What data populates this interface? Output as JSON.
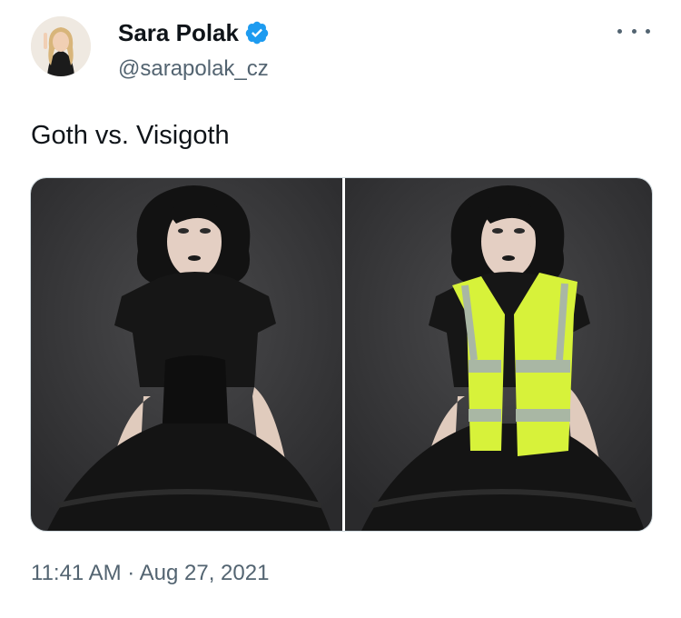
{
  "author": {
    "display_name": "Sara Polak",
    "handle": "@sarapolak_cz",
    "verified": true,
    "avatar_icon": "user-avatar-photo"
  },
  "tweet": {
    "text": "Goth vs. Visigoth",
    "timestamp": "11:41 AM · Aug 27, 2021"
  },
  "media": {
    "photos": [
      {
        "description_icon": "goth-outfit-photo"
      },
      {
        "description_icon": "goth-with-safety-vest-photo"
      }
    ]
  },
  "icons": {
    "more": "more-options-icon",
    "verified": "verified-badge-icon"
  },
  "colors": {
    "verified_blue": "#1d9bf0",
    "secondary_text": "#536471",
    "vest_yellow": "#d7f23a"
  }
}
